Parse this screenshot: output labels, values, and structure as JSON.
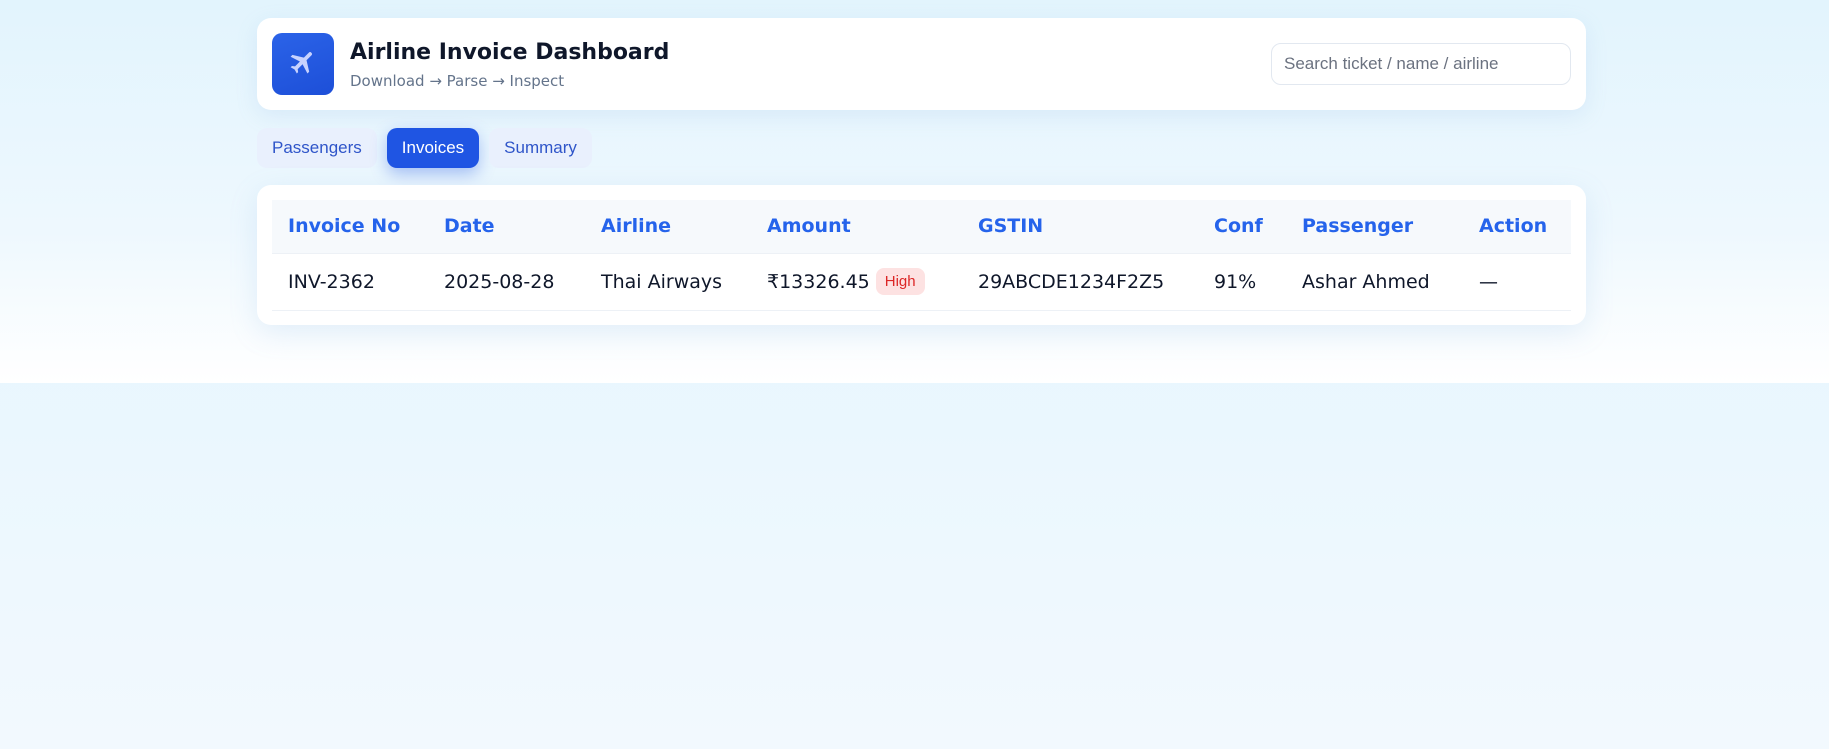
{
  "header": {
    "title": "Airline Invoice Dashboard",
    "subtitle": "Download → Parse → Inspect",
    "logo_icon": "airplane-icon"
  },
  "search": {
    "placeholder": "Search ticket / name / airline",
    "value": ""
  },
  "tabs": [
    {
      "label": "Passengers",
      "active": false
    },
    {
      "label": "Invoices",
      "active": true
    },
    {
      "label": "Summary",
      "active": false
    }
  ],
  "table": {
    "columns": [
      "Invoice No",
      "Date",
      "Airline",
      "Amount",
      "GSTIN",
      "Conf",
      "Passenger",
      "Action"
    ],
    "rows": [
      {
        "invoice_no": "INV-2362",
        "date": "2025-08-28",
        "airline": "Thai Airways",
        "amount": "₹13326.45",
        "badge": "High",
        "gstin": "29ABCDE1234F2Z5",
        "conf": "91%",
        "passenger": "Ashar Ahmed",
        "action": "—"
      }
    ]
  },
  "colors": {
    "accent": "#1f55e3",
    "header_text": "#2563eb",
    "badge_bg": "#fde2e2",
    "badge_text": "#dc2626"
  }
}
